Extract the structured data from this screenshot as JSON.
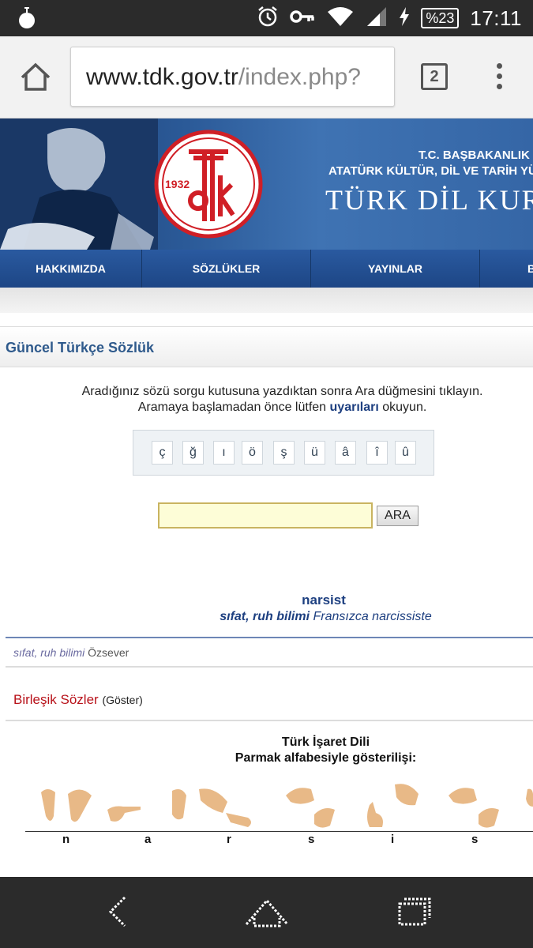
{
  "status_bar": {
    "battery": "%23",
    "time": "17:11",
    "icons": [
      "bomb-icon",
      "alarm-icon",
      "key-icon",
      "wifi-icon",
      "signal-icon",
      "charging-icon"
    ]
  },
  "browser": {
    "url_host": "www.tdk.gov.tr",
    "url_path": "/index.php?",
    "tab_count": "2"
  },
  "banner": {
    "logo_year": "1932",
    "logo_mark": "tdk",
    "gov_line1": "T.C. BAŞBAKANLIK",
    "gov_line2": "ATATÜRK KÜLTÜR, DİL VE TARİH YÜK",
    "org_name": "TÜRK DİL KUR"
  },
  "nav": {
    "items": [
      "HAKKIMIZDA",
      "SÖZLÜKLER",
      "YAYINLAR",
      "B"
    ]
  },
  "section": {
    "title": "Güncel Türkçe Sözlük"
  },
  "instructions": {
    "line1": "Aradığınız sözü sorgu kutusuna yazdıktan sonra Ara düğmesini tıklayın.",
    "line2_prefix": "Aramaya başlamadan önce lütfen",
    "line2_link": "uyarıları",
    "line2_suffix": "okuyun."
  },
  "special_chars": [
    "ç",
    "ğ",
    "ı",
    "ö",
    "ş",
    "ü",
    "â",
    "î",
    "û"
  ],
  "search": {
    "value": "",
    "button_label": "ARA"
  },
  "result": {
    "word": "narsist",
    "pos": "sıfat, ruh bilimi",
    "origin": "Fransızca narcissiste",
    "def_pos": "sıfat, ruh bilimi",
    "def_text": "Özsever",
    "compound_label": "Birleşik Sözler",
    "compound_toggle": "(Göster)"
  },
  "sign_language": {
    "title": "Türk İşaret Dili",
    "subtitle": "Parmak alfabesiyle gösterilişi:",
    "letters": [
      "n",
      "a",
      "r",
      "s",
      "i",
      "s"
    ]
  },
  "colors": {
    "banner_blue": "#2b5a98",
    "nav_blue": "#1d4685",
    "heading_blue": "#2f5a8c",
    "link_blue": "#1d3f80",
    "compound_red": "#b8121a",
    "input_yellow": "#fdfdd7"
  }
}
